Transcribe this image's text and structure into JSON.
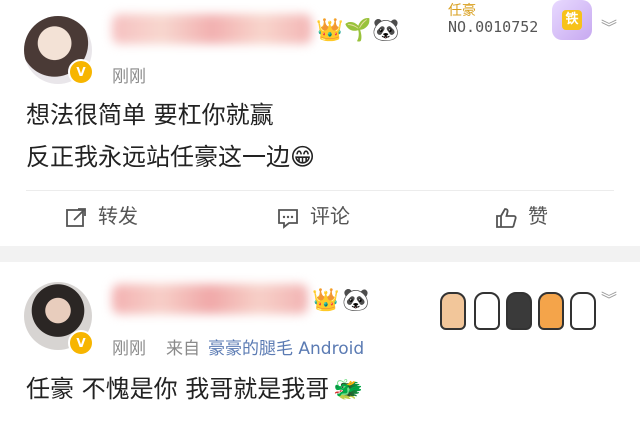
{
  "post1": {
    "time": "刚刚",
    "text_lines": [
      "想法很简单 要杠你就赢",
      "反正我永远站任豪这一边😁"
    ],
    "fan_name": "任豪",
    "fan_number": "NO.0010752",
    "fan_badge": "铁",
    "actions": {
      "repost": "转发",
      "comment": "评论",
      "like": "赞"
    },
    "icons": [
      "crown-icon",
      "plant-emoji-icon",
      "panda-icon",
      "v-badge-icon",
      "repost-icon",
      "comment-icon",
      "like-icon",
      "chevron-down-icon"
    ]
  },
  "post2": {
    "time": "刚刚",
    "source_prefix": "来自",
    "source_link": "豪豪的腿毛 Android",
    "text": "任豪  不愧是你  我哥就是我哥",
    "icons": [
      "crown-icon",
      "panda-icon",
      "cat-paws-icon",
      "v-badge-icon",
      "chevron-down-icon",
      "monster-emoji-icon"
    ]
  },
  "colors": {
    "accent_blue": "#5b7bb3",
    "vip_gold": "#f7b500",
    "blur_name_pink": "#f4b3b3",
    "background": "#f2f2f2"
  }
}
